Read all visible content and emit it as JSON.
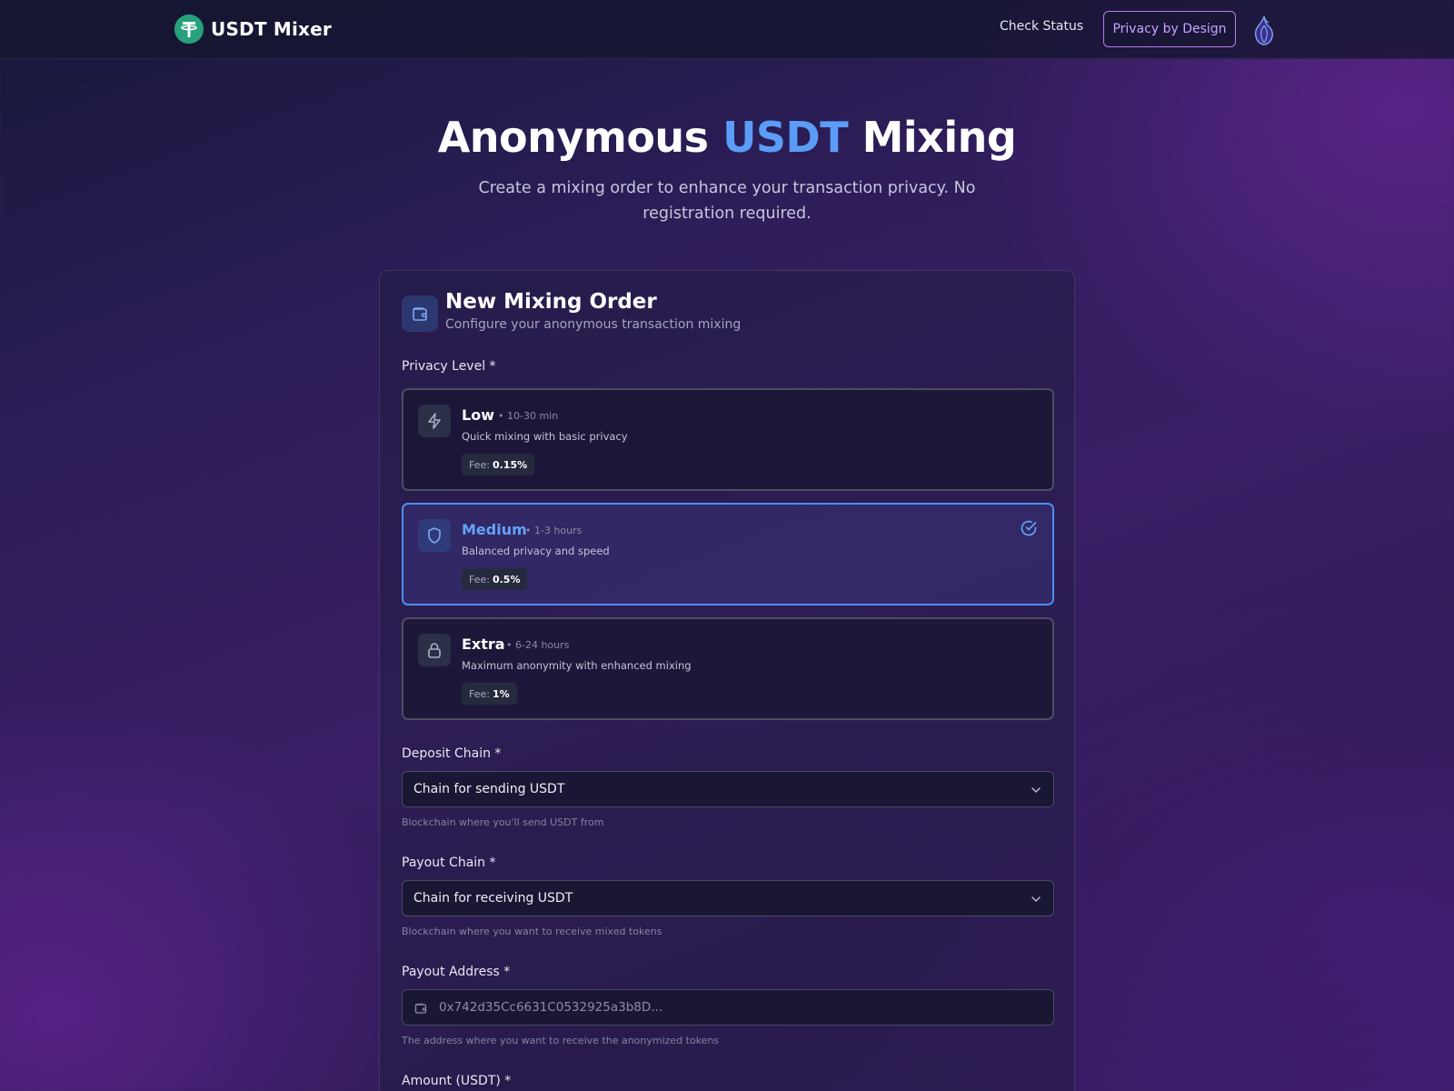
{
  "header": {
    "brand": "USDT Mixer",
    "nav": {
      "check_status": "Check Status",
      "privacy_button": "Privacy by Design"
    }
  },
  "hero": {
    "title_part1": "Anonymous ",
    "title_accent": "USDT",
    "title_part2": " Mixing",
    "subtitle": "Create a mixing order to enhance your transaction privacy. No registration required."
  },
  "order": {
    "title": "New Mixing Order",
    "subtitle": "Configure your anonymous transaction mixing",
    "privacy_label": "Privacy Level *",
    "levels": [
      {
        "name": "Low",
        "time": "• 10-30 min",
        "desc": "Quick mixing with basic privacy",
        "fee_label": "Fee:",
        "fee": "0.15%",
        "icon": "lightning-icon",
        "selected": false
      },
      {
        "name": "Medium",
        "time": "• 1-3 hours",
        "desc": "Balanced privacy and speed",
        "fee_label": "Fee:",
        "fee": "0.5%",
        "icon": "shield-icon",
        "selected": true
      },
      {
        "name": "Extra",
        "time": "• 6-24 hours",
        "desc": "Maximum anonymity with enhanced mixing",
        "fee_label": "Fee:",
        "fee": "1%",
        "icon": "lock-icon",
        "selected": false
      }
    ],
    "deposit": {
      "label": "Deposit Chain *",
      "value": "Chain for sending USDT",
      "hint": "Blockchain where you'll send USDT from"
    },
    "payout_chain": {
      "label": "Payout Chain *",
      "value": "Chain for receiving USDT",
      "hint": "Blockchain where you want to receive mixed tokens"
    },
    "payout_address": {
      "label": "Payout Address *",
      "placeholder": "0x742d35Cc6631C0532925a3b8D...",
      "hint": "The address where you want to receive the anonymized tokens"
    },
    "amount": {
      "label": "Amount (USDT) *"
    }
  },
  "colors": {
    "accent_blue": "#5b9cf6",
    "accent_purple": "#b57cf0",
    "tether_green": "#26a17b",
    "selected_border": "#4d8ef5"
  }
}
